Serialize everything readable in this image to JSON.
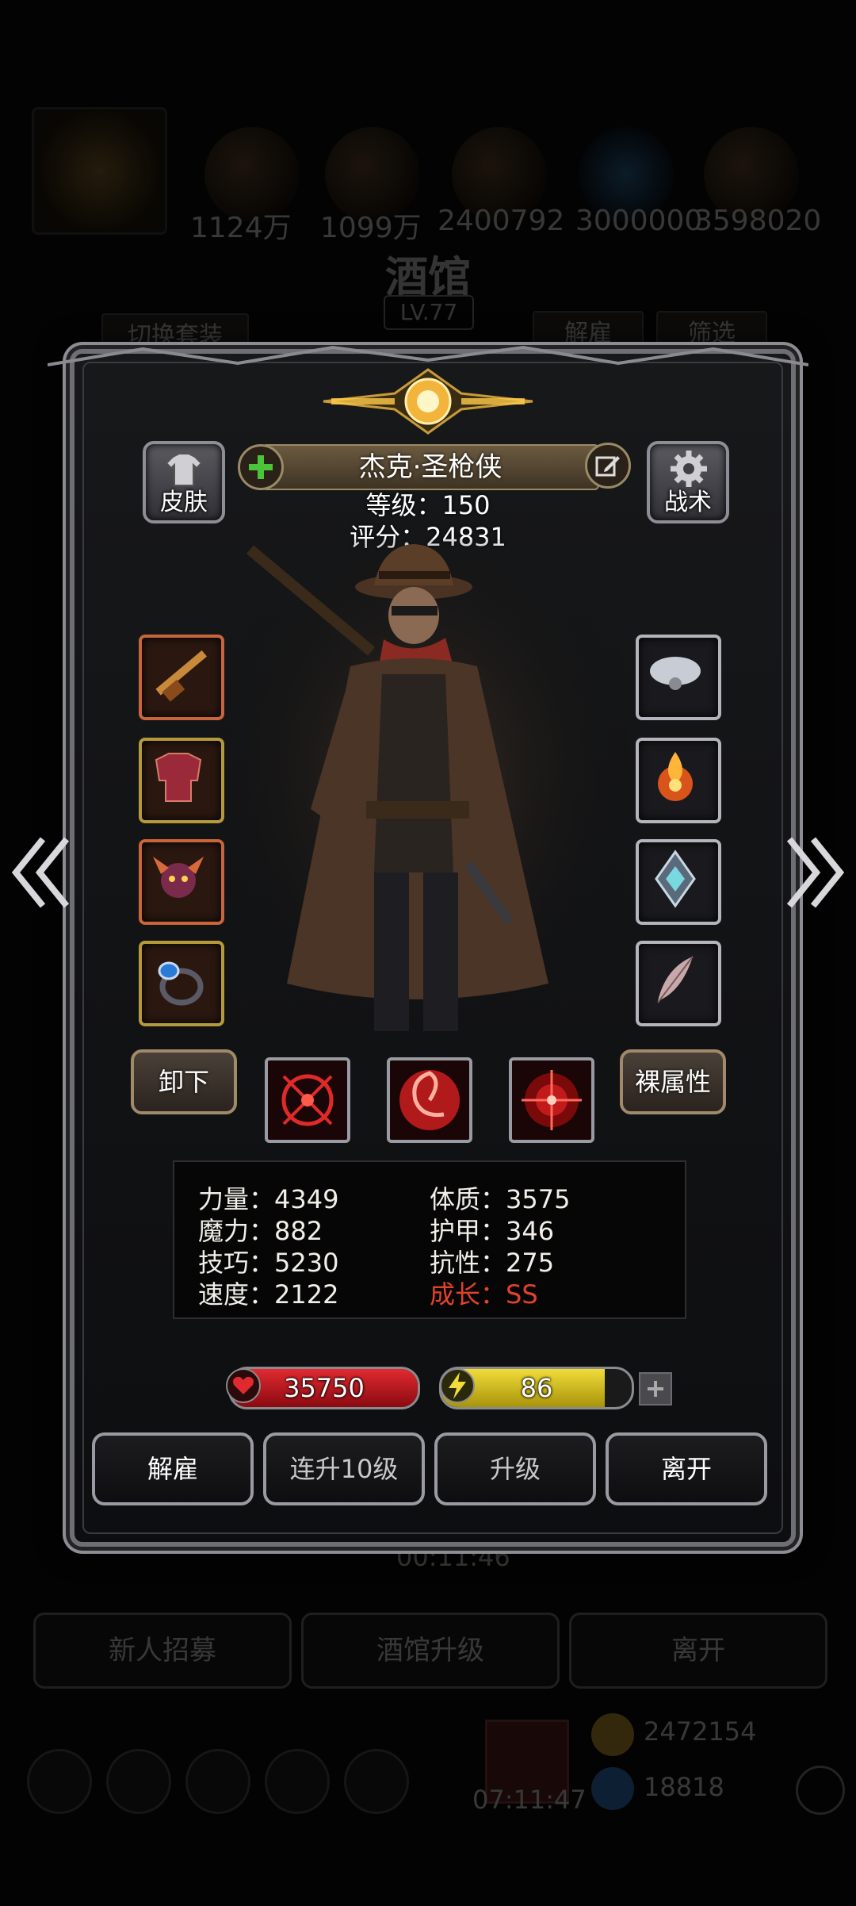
{
  "background": {
    "resources": [
      "1124万",
      "1099万",
      "2400792",
      "3000000",
      "3598020"
    ],
    "title": "酒馆",
    "level": "LV.77",
    "switch_outfit": "切换套装",
    "dismiss": "解雇",
    "filter": "筛选",
    "timer": "00:11:46",
    "buttons": [
      "新人招募",
      "酒馆升级",
      "离开"
    ],
    "currency1": "2472154",
    "currency2": "18818",
    "clock": "07:11:47"
  },
  "hero": {
    "name": "杰克·圣枪侠",
    "level_text": "等级：150",
    "score_text": "评分：24831"
  },
  "buttons": {
    "skin": "皮肤",
    "tactics": "战术",
    "unequip": "卸下",
    "base_attr": "裸属性",
    "dismiss": "解雇",
    "level_up_10": "连升10级",
    "level_up": "升级",
    "leave": "离开"
  },
  "stats": {
    "strength": "力量：4349",
    "magic": "魔力：882",
    "skill": "技巧：5230",
    "speed": "速度：2122",
    "constitution": "体质：3575",
    "armor": "护甲：346",
    "resistance": "抗性：275",
    "growth": "成长：SS"
  },
  "bars": {
    "hp": "35750",
    "energy": "86",
    "energy_fraction": 0.86
  },
  "icons": {
    "left_equipment": [
      "rifle-icon",
      "chest-armor-icon",
      "demon-helm-icon",
      "sapphire-ring-icon"
    ],
    "right_equipment": [
      "cloud-amulet-icon",
      "flame-orb-icon",
      "crystal-emblem-icon",
      "feather-icon"
    ],
    "skills": [
      "red-crosshair-icon",
      "red-vortex-icon",
      "red-target-icon"
    ]
  },
  "colors": {
    "growth": "#e0422a",
    "hp_fill": "#c0141c",
    "energy_fill": "#d9c21a",
    "gold_frame": "#b49a3a"
  }
}
